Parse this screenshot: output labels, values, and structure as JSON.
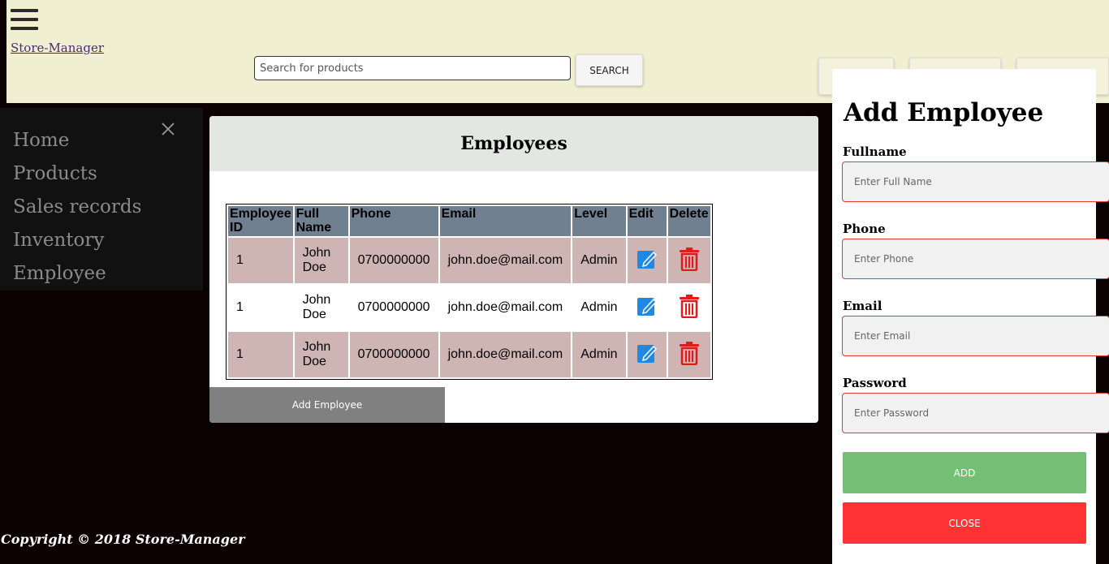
{
  "header": {
    "brand": "Store-Manager",
    "search_placeholder": "Search for products",
    "search_button": "SEARCH"
  },
  "sidebar": {
    "items": [
      "Home",
      "Products",
      "Sales records",
      "Inventory",
      "Employee"
    ]
  },
  "employees_panel": {
    "title": "Employees",
    "columns": [
      "Employee ID",
      "Full Name",
      "Phone",
      "Email",
      "Level",
      "Edit",
      "Delete"
    ],
    "rows": [
      {
        "id": "1",
        "name": "John Doe",
        "phone": "0700000000",
        "email": "john.doe@mail.com",
        "level": "Admin"
      },
      {
        "id": "1",
        "name": "John Doe",
        "phone": "0700000000",
        "email": "john.doe@mail.com",
        "level": "Admin"
      },
      {
        "id": "1",
        "name": "John Doe",
        "phone": "0700000000",
        "email": "john.doe@mail.com",
        "level": "Admin"
      }
    ],
    "add_button": "Add Employee"
  },
  "add_employee_form": {
    "title": "Add Employee",
    "fields": [
      {
        "label": "Fullname",
        "placeholder": "Enter Full Name"
      },
      {
        "label": "Phone",
        "placeholder": "Enter Phone"
      },
      {
        "label": "Email",
        "placeholder": "Enter Email"
      },
      {
        "label": "Password",
        "placeholder": "Enter Password"
      }
    ],
    "add_button": "ADD",
    "close_button": "CLOSE"
  },
  "footer": {
    "copyright": "Copyright © 2018 Store-Manager"
  },
  "colors": {
    "topbar": "#f1efd1",
    "table_header": "#708090",
    "row_shade": "#cfb4b4",
    "edit_icon": "#1e88e5",
    "delete_icon": "#e01b1b",
    "add_button": "#73bf73",
    "close_button": "#ff3333"
  }
}
